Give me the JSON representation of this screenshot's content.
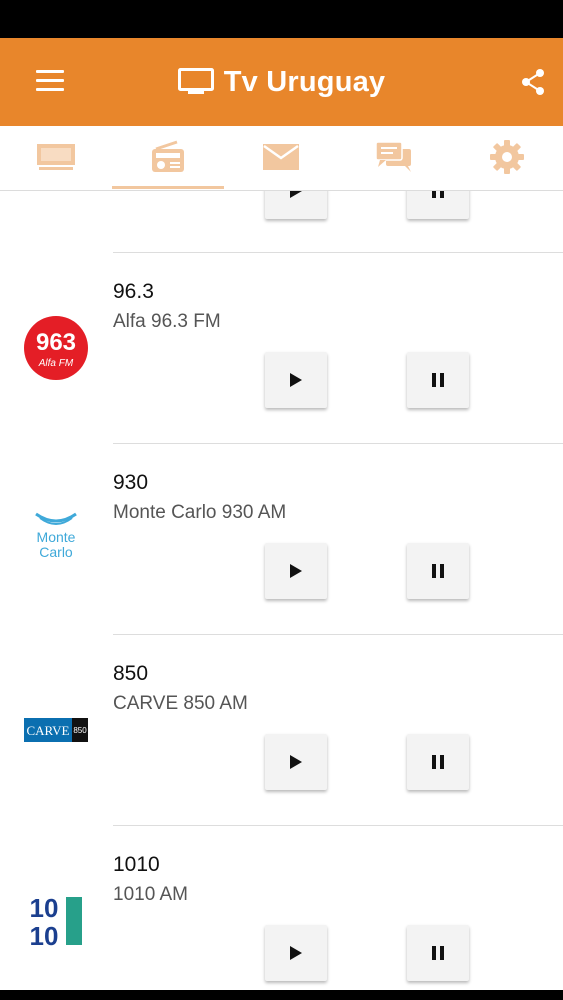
{
  "app": {
    "title": "Tv Uruguay",
    "colors": {
      "app_bar": "#e8862b",
      "tab_icon": "#f2c79f",
      "text_primary": "#111111",
      "text_secondary": "#555555"
    }
  },
  "header": {
    "menu_icon": "menu-icon",
    "tv_icon": "tv-icon",
    "share_icon": "share-icon"
  },
  "tabs": [
    {
      "icon": "tv-icon",
      "active": false
    },
    {
      "icon": "radio-icon",
      "active": true
    },
    {
      "icon": "mail-icon",
      "active": false
    },
    {
      "icon": "chat-icon",
      "active": false
    },
    {
      "icon": "gear-icon",
      "active": false
    }
  ],
  "stations": [
    {
      "frequency": "96.3",
      "name": "Alfa 96.3 FM",
      "logo_text": "963",
      "logo_sub": "Alfa FM"
    },
    {
      "frequency": "930",
      "name": "Monte Carlo 930 AM",
      "logo_text": "Monte",
      "logo_sub": "Carlo"
    },
    {
      "frequency": "850",
      "name": "CARVE 850 AM",
      "logo_text": "CARVE",
      "logo_sub": "850"
    },
    {
      "frequency": "1010",
      "name": "1010 AM",
      "logo_text": "10",
      "logo_sub": "10"
    }
  ]
}
